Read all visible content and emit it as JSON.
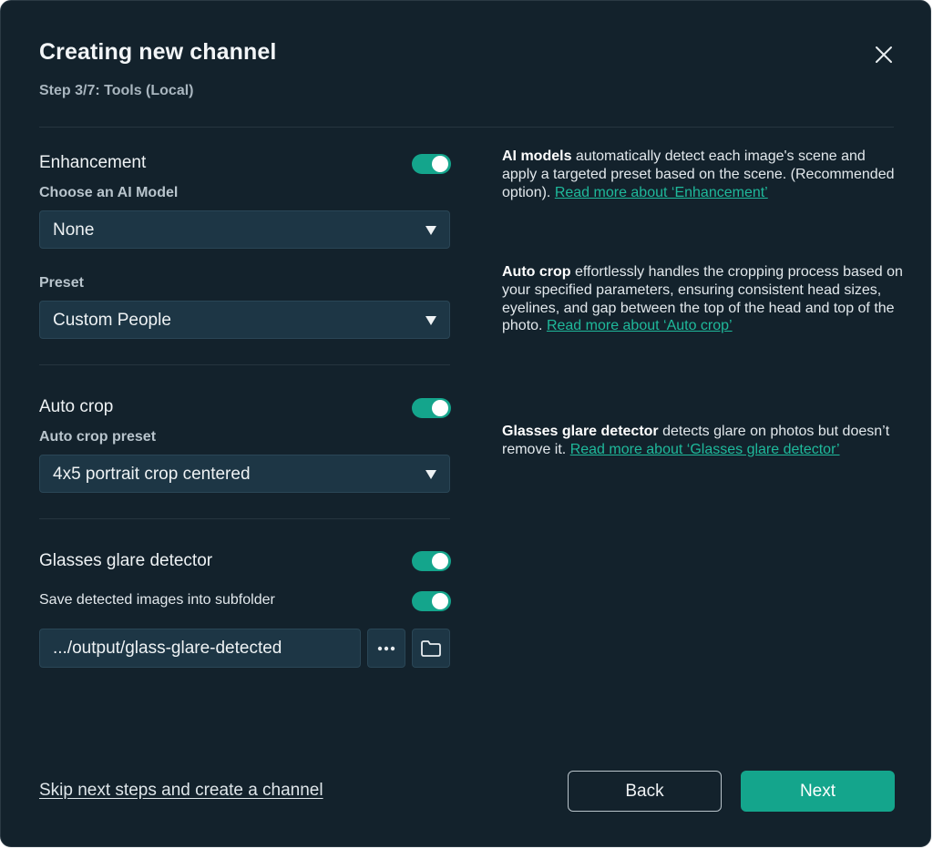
{
  "dialog": {
    "title": "Creating new channel",
    "step": "Step 3/7: Tools (Local)"
  },
  "enhancement": {
    "title": "Enhancement",
    "enabled": true,
    "model_label": "Choose an AI Model",
    "model_value": "None",
    "preset_label": "Preset",
    "preset_value": "Custom People"
  },
  "autocrop": {
    "title": "Auto crop",
    "enabled": true,
    "preset_label": "Auto crop preset",
    "preset_value": "4x5 portrait crop centered"
  },
  "glare": {
    "title": "Glasses glare detector",
    "enabled": true,
    "save_label": "Save detected images into subfolder",
    "save_enabled": true,
    "folder_value": ".../output/glass-glare-detected"
  },
  "descriptions": {
    "ai_models": {
      "bold": "AI models",
      "text": " automatically detect each image's scene and apply a targeted preset based on the scene. (Recommended option). ",
      "link": "Read more about ‘Enhancement’"
    },
    "auto_crop": {
      "bold": "Auto crop",
      "text": " effortlessly handles the cropping process based on your specified parameters, ensuring consistent head sizes, eyelines, and gap between the top of the head and top of the photo. ",
      "link": "Read more about ‘Auto crop’"
    },
    "glare": {
      "bold": "Glasses glare detector",
      "text": " detects glare on photos but doesn’t remove it. ",
      "link": "Read more about ‘Glasses glare detector’"
    }
  },
  "footer": {
    "skip_label": "Skip next steps and create a channel",
    "back_label": "Back",
    "next_label": "Next"
  },
  "colors": {
    "background": "#13222c",
    "accent": "#14a58c",
    "field": "#1d3645",
    "link": "#1fb99b"
  },
  "icons": {
    "close": "close-icon",
    "caret": "caret-down-icon",
    "more": "more-horizontal-icon",
    "folder": "folder-icon"
  }
}
